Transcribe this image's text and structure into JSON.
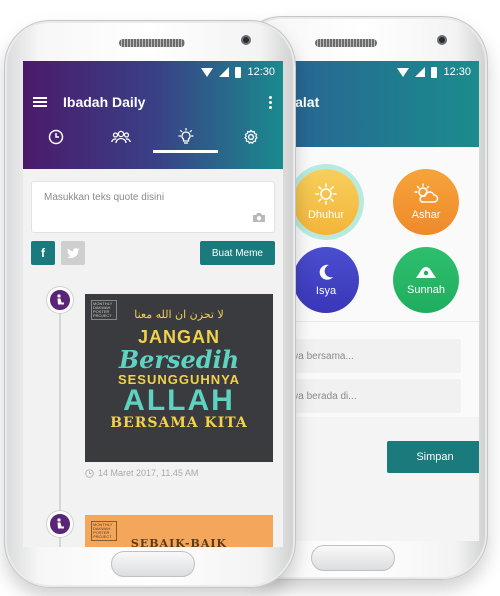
{
  "front_phone": {
    "status": {
      "time": "12:30"
    },
    "app_title": "Ibadah Daily",
    "tabs": [
      {
        "icon": "clock-icon",
        "active": false
      },
      {
        "icon": "people-icon",
        "active": false
      },
      {
        "icon": "lightbulb-icon",
        "active": true
      },
      {
        "icon": "gear-icon",
        "active": false
      }
    ],
    "quote_placeholder": "Masukkan teks quote disini",
    "share": {
      "facebook_label": "f",
      "twitter_icon": "twitter-icon"
    },
    "make_meme_label": "Buat Meme",
    "post1": {
      "poster_logo": "MONTHLY DAKWAH POSTER PROJECT",
      "arabic": "لا تحزن ان الله معنا",
      "line1": "JANGAN",
      "line2": "Bersedih",
      "line3": "SESUNGGUHNYA",
      "line4": "ALLAH",
      "line5": "BERSAMA KITA",
      "timestamp": "14 Maret 2017, 11.45 AM"
    },
    "post2": {
      "poster_logo": "MONTHLY DAKWAH POSTER PROJECT",
      "text": "SEBAIK-BAIK"
    }
  },
  "back_phone": {
    "status": {
      "time": "12:30"
    },
    "title": "ah Shalat",
    "prayers": [
      {
        "name": "Dhuhur",
        "icon": "sun-icon"
      },
      {
        "name": "Ashar",
        "icon": "sun-cloud-icon"
      },
      {
        "name": "Isya",
        "icon": "moon-icon"
      },
      {
        "name": "Sunnah",
        "icon": "prayer-mat-icon"
      }
    ],
    "field1_placeholder": "Saya bersama...",
    "field2_placeholder": "Saya berada di...",
    "save_label": "Simpan"
  },
  "colors": {
    "header_left": "#4b1a6b",
    "header_right": "#1a8a8e",
    "accent_teal": "#1a7a7c"
  }
}
